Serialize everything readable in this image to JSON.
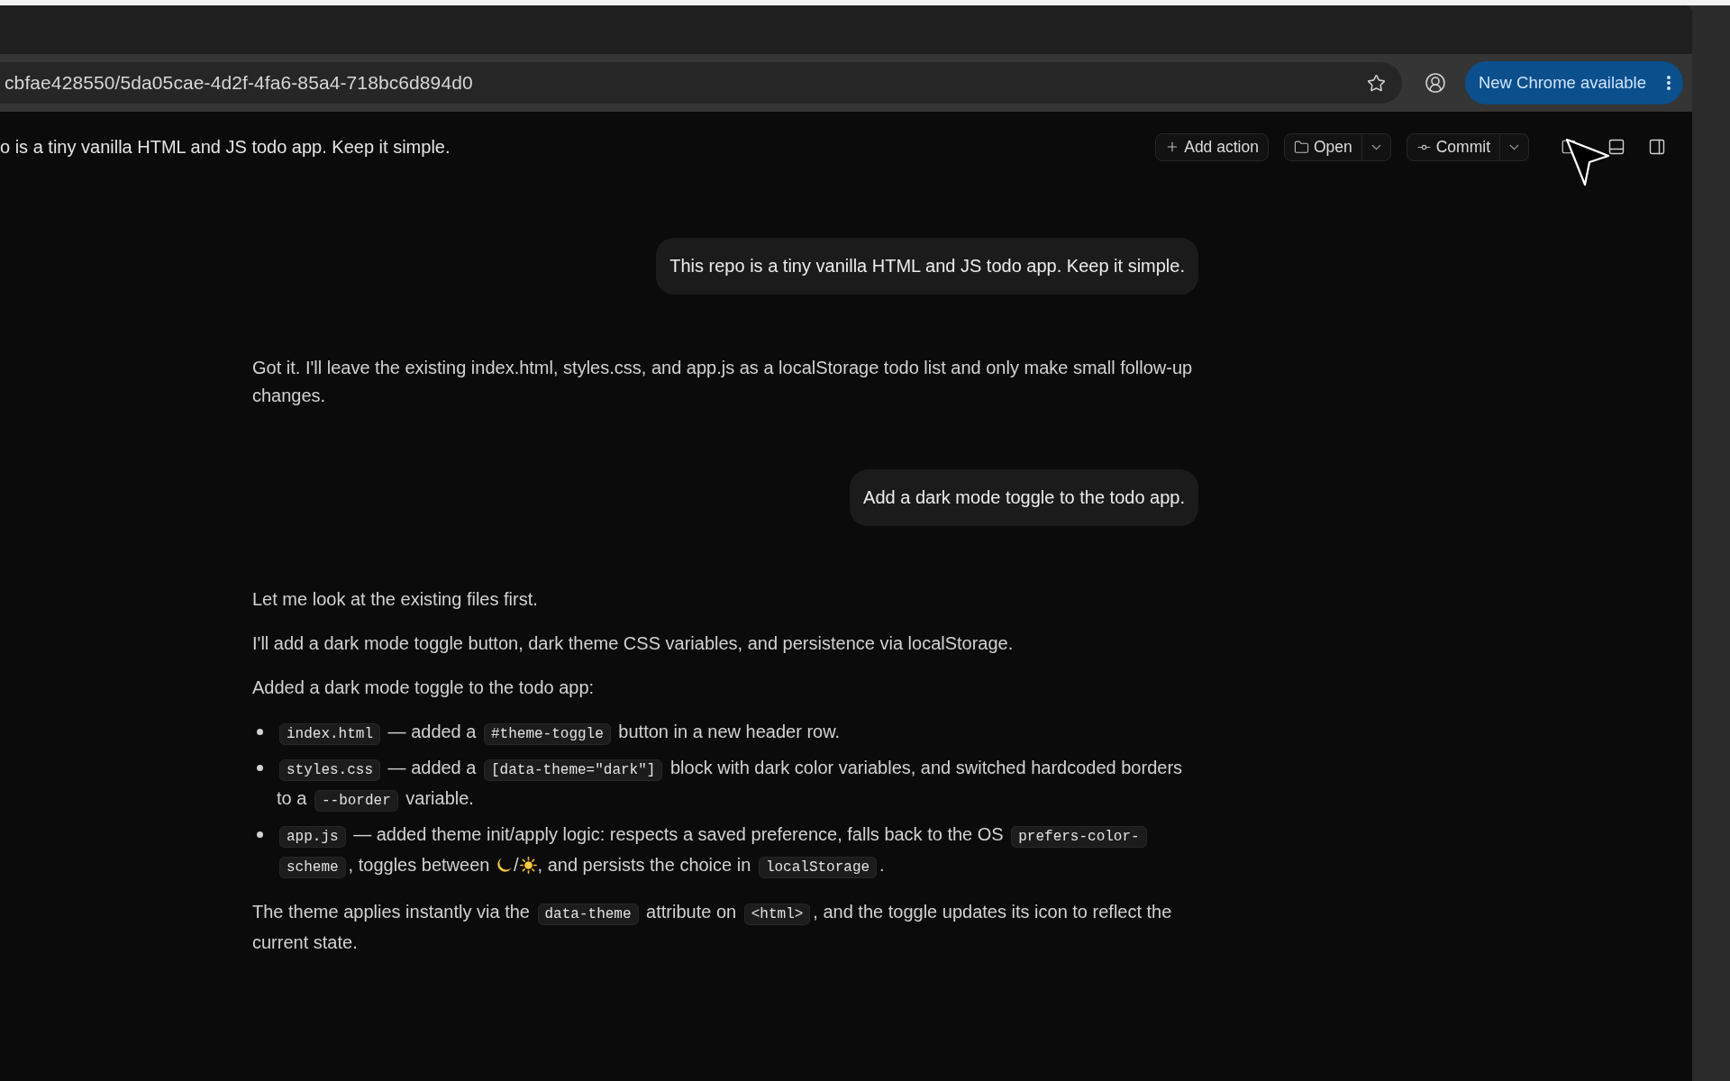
{
  "browser": {
    "address": "cbfae428550/5da05cae-4d2f-4fa6-85a4-718bc6d894d0",
    "update_button": "New Chrome available"
  },
  "header": {
    "title": "o is a tiny vanilla HTML and JS todo app. Keep it simple.",
    "actions": [
      {
        "kind": "add",
        "label": "Add action"
      },
      {
        "kind": "open",
        "label": "Open"
      },
      {
        "kind": "commit",
        "label": "Commit"
      }
    ]
  },
  "messages": [
    {
      "kind": "user",
      "text": "This repo is a tiny vanilla HTML and JS todo app. Keep it simple."
    },
    {
      "kind": "assistant",
      "blocks": [
        {
          "kind": "paragraph",
          "segments": [
            {
              "kind": "text",
              "text": "Got it. I'll leave the existing index.html, styles.css, and app.js as a localStorage todo list and only make small follow-up changes."
            }
          ]
        }
      ]
    },
    {
      "kind": "user",
      "text": "Add a dark mode toggle to the todo app."
    },
    {
      "kind": "assistant",
      "blocks": [
        {
          "kind": "paragraph",
          "segments": [
            {
              "kind": "text",
              "text": "Let me look at the existing files first."
            }
          ]
        },
        {
          "kind": "paragraph",
          "segments": [
            {
              "kind": "text",
              "text": "I'll add a dark mode toggle button, dark theme CSS variables, and persistence via localStorage."
            }
          ]
        },
        {
          "kind": "paragraph",
          "segments": [
            {
              "kind": "text",
              "text": "Added a dark mode toggle to the todo app:"
            }
          ]
        },
        {
          "kind": "bullets",
          "items": [
            {
              "segments": [
                {
                  "kind": "code",
                  "text": "index.html"
                },
                {
                  "kind": "text",
                  "text": " — added a "
                },
                {
                  "kind": "code",
                  "text": "#theme-toggle"
                },
                {
                  "kind": "text",
                  "text": " button in a new header row."
                }
              ]
            },
            {
              "segments": [
                {
                  "kind": "code",
                  "text": "styles.css"
                },
                {
                  "kind": "text",
                  "text": " — added a "
                },
                {
                  "kind": "code",
                  "text": "[data-theme=\"dark\"]"
                },
                {
                  "kind": "text",
                  "text": " block with dark color variables, and switched hardcoded borders to a "
                },
                {
                  "kind": "code",
                  "text": "--border"
                },
                {
                  "kind": "text",
                  "text": " variable."
                }
              ]
            },
            {
              "segments": [
                {
                  "kind": "code",
                  "text": "app.js"
                },
                {
                  "kind": "text",
                  "text": " — added theme init/apply logic: respects a saved preference, falls back to the OS "
                },
                {
                  "kind": "code",
                  "text": "prefers-color-"
                },
                {
                  "kind": "code",
                  "text": "scheme"
                },
                {
                  "kind": "text",
                  "text": ", toggles between "
                },
                {
                  "kind": "moon_icon"
                },
                {
                  "kind": "text",
                  "text": "/"
                },
                {
                  "kind": "sun_icon"
                },
                {
                  "kind": "text",
                  "text": ", and persists the choice in "
                },
                {
                  "kind": "code",
                  "text": "localStorage"
                },
                {
                  "kind": "text",
                  "text": "."
                }
              ]
            }
          ]
        },
        {
          "kind": "paragraph",
          "segments": [
            {
              "kind": "text",
              "text": "The theme applies instantly via the "
            },
            {
              "kind": "code",
              "text": "data-theme"
            },
            {
              "kind": "text",
              "text": " attribute on "
            },
            {
              "kind": "code",
              "text": "<html>"
            },
            {
              "kind": "text",
              "text": ", and the toggle updates its icon to reflect the current state."
            }
          ]
        }
      ]
    }
  ]
}
